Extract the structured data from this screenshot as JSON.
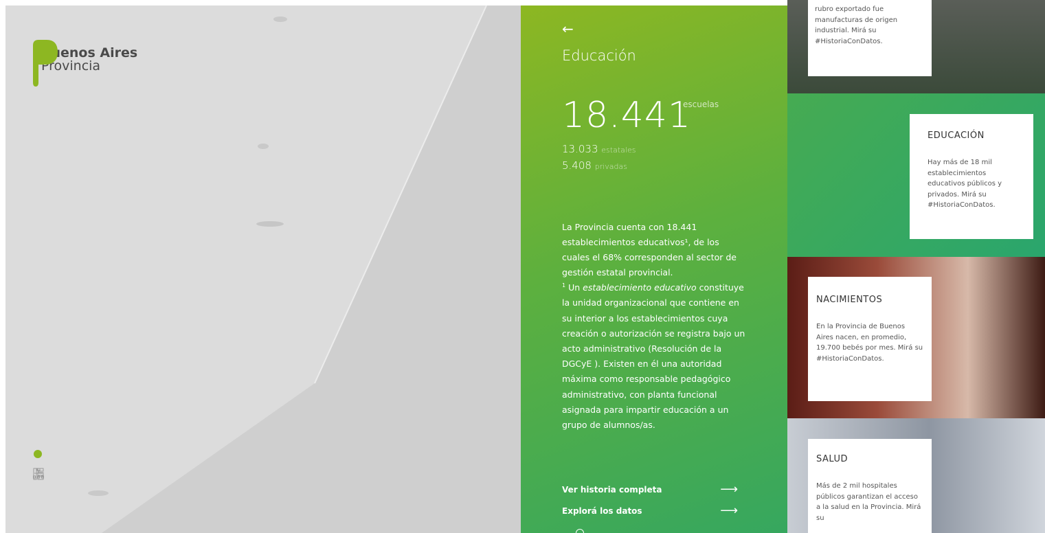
{
  "brand": {
    "line1": "Buenos Aires",
    "line2": "Provincia",
    "color": "#8db722"
  },
  "sidebar": {
    "icons": [
      "dot-indicator",
      "list-tree-icon",
      "org-chart-icon"
    ]
  },
  "panel": {
    "back_arrow": "←",
    "title": "Educación",
    "big_number": "18.441",
    "big_unit": "escuelas",
    "sub1_value": "13.033",
    "sub1_unit": "estatales",
    "sub2_value": "5.408",
    "sub2_unit": "privadas",
    "para1": "La Provincia cuenta con 18.441 establecimientos educativos¹, de los cuales el 68% corresponden al sector de gestión estatal provincial.",
    "footnote_mark": "1",
    "footnote_italic": "establecimiento educativo",
    "footnote_text": "constituye la unidad organizacional que contiene en su interior a los establecimientos cuya creación o autorización se registra bajo un acto administrativo (Resolución de la DGCyE ). Existen en él una autoridad máxima como responsable pedagógico administrativo, con planta funcional asignada para impartir educación a un grupo de alumnos/as.",
    "link1": "Ver historia completa",
    "link2": "Explorá los datos",
    "arrow": "⟶"
  },
  "cards": [
    {
      "title": "",
      "text": "rubro exportado fue manufacturas de origen industrial. Mirá su #HistoriaConDatos."
    },
    {
      "title": "EDUCACIÓN",
      "text": "Hay más de 18 mil establecimientos educativos públicos y privados. Mirá su #HistoriaConDatos."
    },
    {
      "title": "NACIMIENTOS",
      "text": "En la Provincia de Buenos Aires nacen, en promedio, 19.700 bebés por mes. Mirá su #HistoriaConDatos."
    },
    {
      "title": "SALUD",
      "text": "Más de 2 mil hospitales públicos garantizan el acceso a la salud en la Provincia. Mirá su"
    }
  ]
}
